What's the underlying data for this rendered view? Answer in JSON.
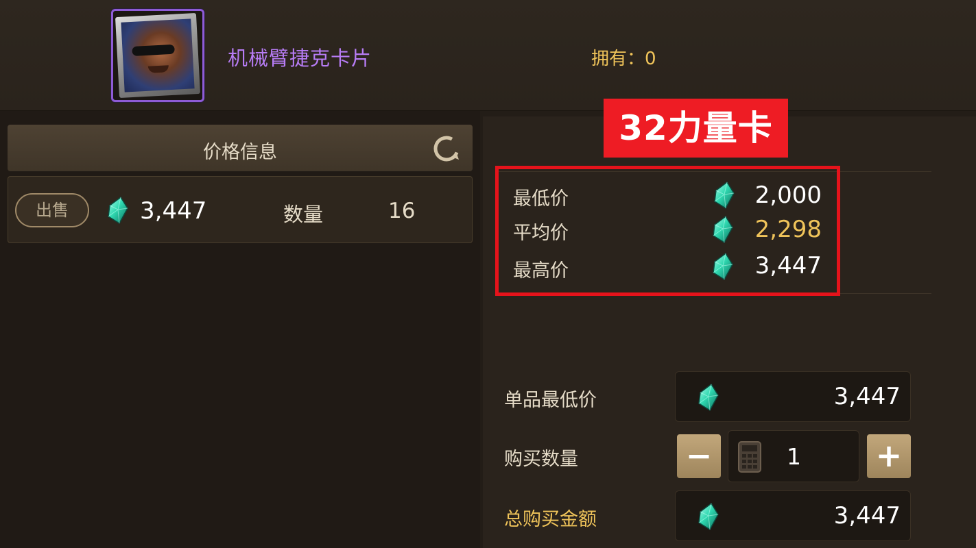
{
  "item": {
    "name": "机械臂捷克卡片",
    "owned_text": "拥有：0",
    "rarity_color": "#8e5bd6"
  },
  "price_panel": {
    "title": "价格信息",
    "refresh_icon": "refresh-icon"
  },
  "listings": [
    {
      "badge": "出售",
      "price": "3,447",
      "qty_label": "数量",
      "qty": "16"
    }
  ],
  "stats": {
    "rows": [
      {
        "label": "最低价",
        "value": "2,000"
      },
      {
        "label": "平均价",
        "value": "2,298"
      },
      {
        "label": "最高价",
        "value": "3,447"
      }
    ]
  },
  "overlay": {
    "text": "32力量卡",
    "color": "#ee1c24"
  },
  "purchase": {
    "unit_min_label": "单品最低价",
    "unit_min_value": "3,447",
    "qty_label": "购买数量",
    "qty_value": "1",
    "minus_label": "−",
    "plus_label": "+",
    "total_label": "总购买金额",
    "total_value": "3,447"
  },
  "colors": {
    "accent_gold": "#f0c45a",
    "item_purple": "#b77cf5",
    "button_tan": "#b09570",
    "gem_teal": "#2fd8b0"
  }
}
